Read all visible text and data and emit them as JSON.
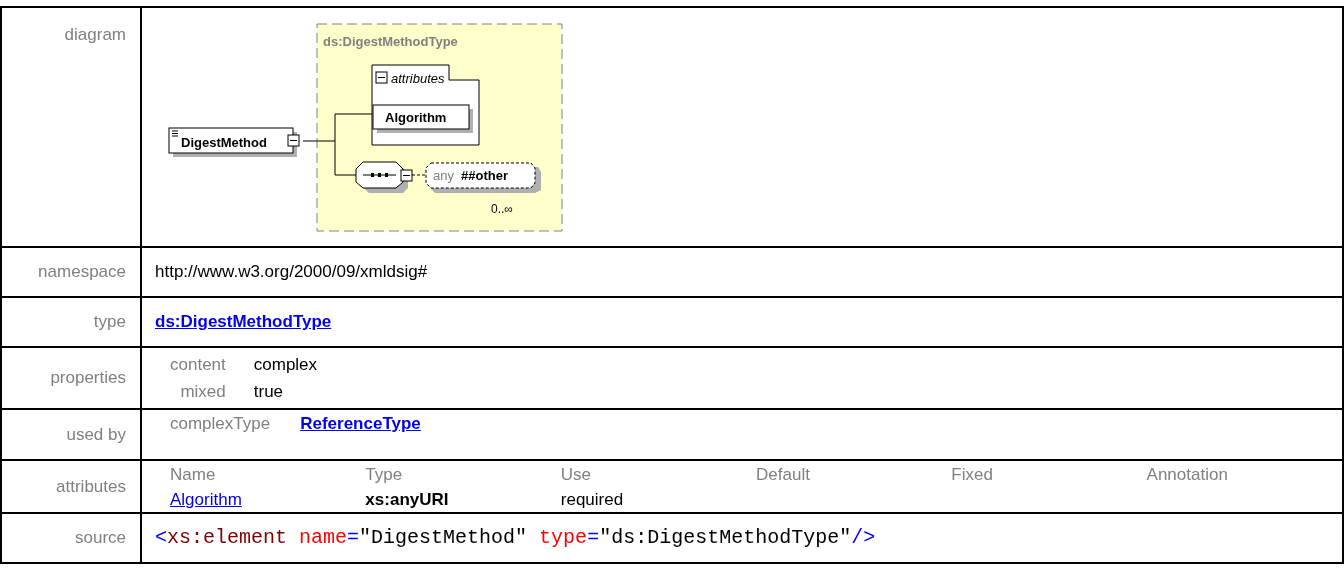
{
  "diagram": {
    "label": "diagram",
    "type_title": "ds:DigestMethodType",
    "element": "DigestMethod",
    "attributes_label": "attributes",
    "attributes": [
      "Algorithm"
    ],
    "any_prefix": "any",
    "any_namespace": "##other",
    "any_occurs": "0..∞"
  },
  "namespace": {
    "label": "namespace",
    "value": "http://www.w3.org/2000/09/xmldsig#"
  },
  "type": {
    "label": "type",
    "value": "ds:DigestMethodType"
  },
  "properties": {
    "label": "properties",
    "items": [
      {
        "name": "content",
        "value": "complex"
      },
      {
        "name": "mixed",
        "value": "true"
      }
    ]
  },
  "used_by": {
    "label": "used by",
    "kind": "complexType",
    "value": "ReferenceType"
  },
  "attributes": {
    "label": "attributes",
    "columns": [
      "Name",
      "Type",
      "Use",
      "Default",
      "Fixed",
      "Annotation"
    ],
    "rows": [
      [
        "Algorithm",
        "xs:anyURI",
        "required"
      ]
    ]
  },
  "source": {
    "label": "source",
    "tokens": [
      {
        "kind": "punct",
        "text": "<"
      },
      {
        "kind": "tag",
        "text": "xs:element"
      },
      {
        "kind": "attr",
        "text": " name"
      },
      {
        "kind": "punct",
        "text": "="
      },
      {
        "kind": "value",
        "text": "\"DigestMethod\""
      },
      {
        "kind": "attr",
        "text": " type"
      },
      {
        "kind": "punct",
        "text": "="
      },
      {
        "kind": "value",
        "text": "\"ds:DigestMethodType\""
      },
      {
        "kind": "punct",
        "text": "/>"
      }
    ]
  }
}
